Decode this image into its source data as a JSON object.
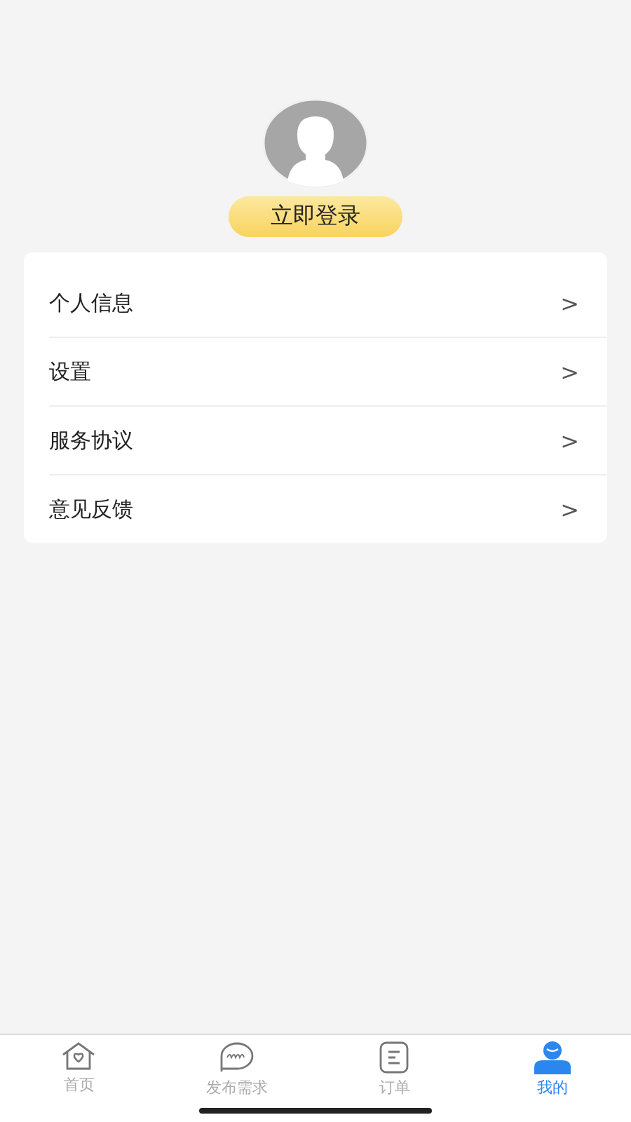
{
  "login_button": "立即登录",
  "menu": [
    {
      "label": "个人信息",
      "chevron": ">"
    },
    {
      "label": "设置",
      "chevron": ">"
    },
    {
      "label": "服务协议",
      "chevron": ">"
    },
    {
      "label": "意见反馈",
      "chevron": ">"
    }
  ],
  "tabs": [
    {
      "kind": "home",
      "label": "首页",
      "selected": false
    },
    {
      "kind": "post",
      "label": "发布需求",
      "selected": false
    },
    {
      "kind": "orders",
      "label": "订单",
      "selected": false
    },
    {
      "kind": "me",
      "label": "我的",
      "selected": true
    }
  ]
}
